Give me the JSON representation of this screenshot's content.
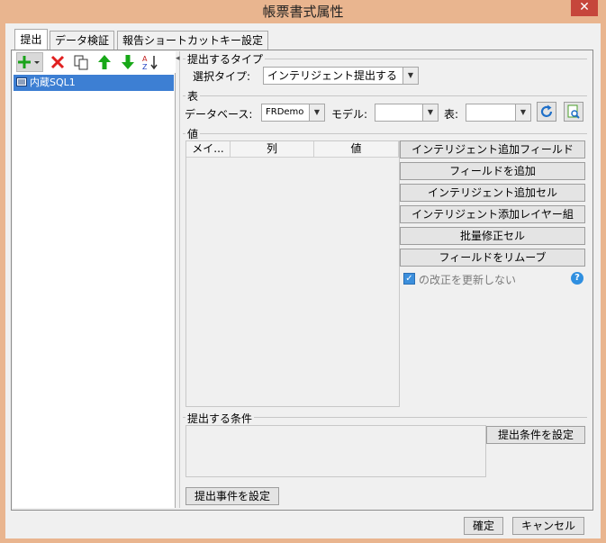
{
  "window": {
    "title": "帳票書式属性",
    "close_glyph": "✕"
  },
  "tabs": [
    {
      "label": "提出"
    },
    {
      "label": "データ検証"
    },
    {
      "label": "報告ショートカットキー設定"
    }
  ],
  "left_toolbar": {
    "icons": [
      "add-icon",
      "delete-icon",
      "copy-icon",
      "move-up-icon",
      "move-down-icon",
      "sort-icon"
    ],
    "colors": {
      "add": "#1aa31a",
      "delete": "#e02020",
      "up": "#18a818",
      "down": "#18a818"
    }
  },
  "submissions": [
    {
      "label": "内蔵SQL1",
      "selected": true
    }
  ],
  "submit_type": {
    "group_title": "提出するタイプ",
    "label": "選択タイプ:",
    "value": "インテリジェント提出する"
  },
  "table_group": {
    "group_title": "表",
    "database_label": "データベース:",
    "database_value": "FRDemo",
    "model_label": "モデル:",
    "model_value": "",
    "table_label": "表:",
    "table_value": ""
  },
  "values_group": {
    "group_title": "値",
    "columns": [
      "メイ...",
      "列",
      "値"
    ],
    "buttons": [
      "インテリジェント追加フィールド",
      "フィールドを追加",
      "インテリジェント追加セル",
      "インテリジェント添加レイヤー組",
      "批量修正セル",
      "フィールドをリムーブ"
    ],
    "checkbox_label": "の改正を更新しない",
    "checkbox_checked": true
  },
  "condition_group": {
    "group_title": "提出する条件",
    "button": "提出条件を設定"
  },
  "event_button": "提出事件を設定",
  "footer": {
    "ok": "確定",
    "cancel": "キャンセル"
  },
  "accent": "#3d7fd3"
}
